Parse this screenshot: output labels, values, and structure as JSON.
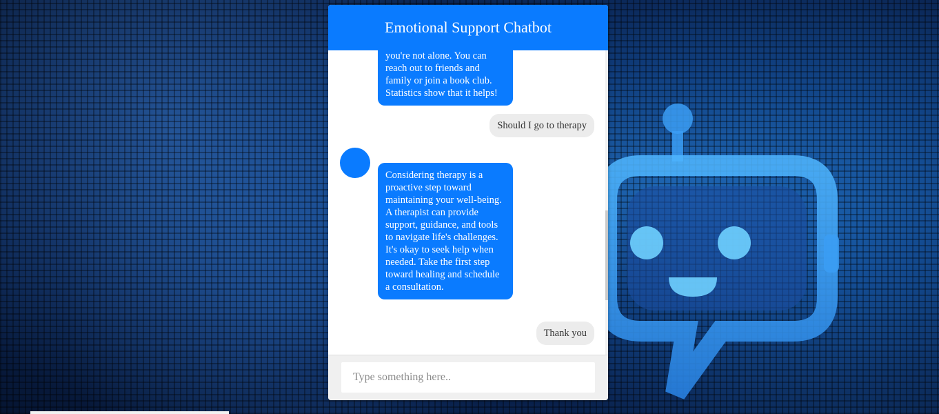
{
  "header": {
    "title": "Emotional Support Chatbot"
  },
  "messages": [
    {
      "sender": "bot",
      "text": "you're not alone. You can reach out to friends and family or join a book club. Statistics show that it helps!"
    },
    {
      "sender": "user",
      "text": "Should I go to therapy"
    },
    {
      "sender": "bot",
      "text": "Considering therapy is a proactive step toward maintaining your well-being. A therapist can provide support, guidance, and tools to navigate life's challenges. It's okay to seek help when needed. Take the first step toward healing and schedule a consultation."
    },
    {
      "sender": "user",
      "text": "Thank you"
    }
  ],
  "input": {
    "placeholder": "Type something here.."
  },
  "colors": {
    "accent": "#0a7bff",
    "user_bubble": "#ececec",
    "input_bar": "#f0f0f0"
  },
  "icons": {
    "bot_avatar": "bot-avatar-circle",
    "background_robot": "robot-chat-icon"
  }
}
